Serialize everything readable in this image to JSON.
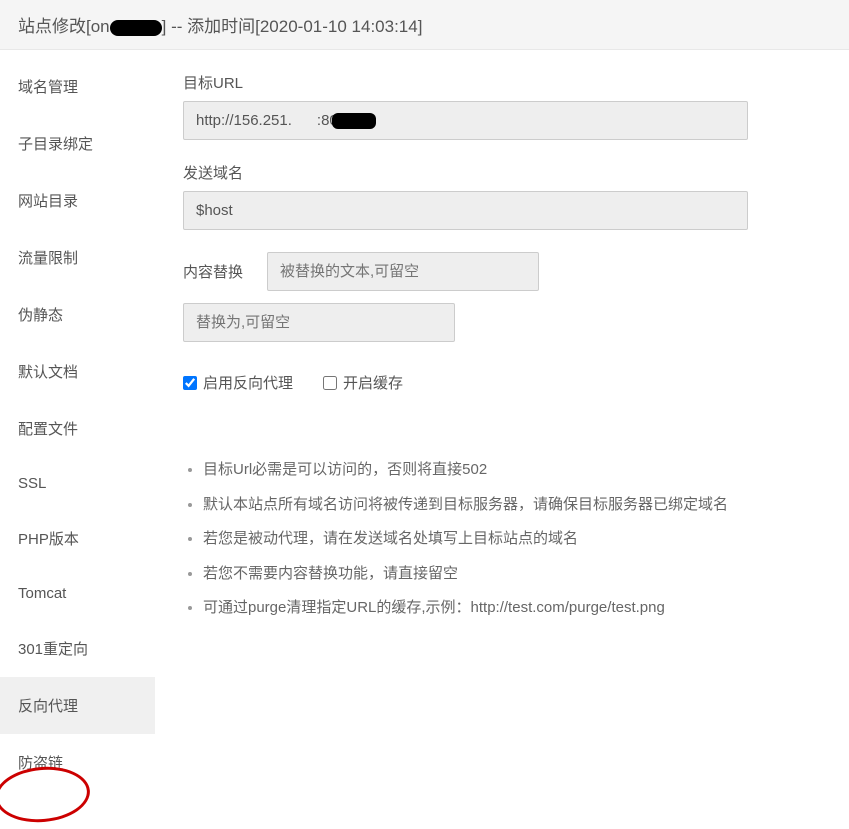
{
  "header": {
    "prefix": "站点修改[on",
    "suffix": "] -- 添加时间[2020-01-10 14:03:14]"
  },
  "sidebar": {
    "items": [
      {
        "label": "域名管理"
      },
      {
        "label": "子目录绑定"
      },
      {
        "label": "网站目录"
      },
      {
        "label": "流量限制"
      },
      {
        "label": "伪静态"
      },
      {
        "label": "默认文档"
      },
      {
        "label": "配置文件"
      },
      {
        "label": "SSL"
      },
      {
        "label": "PHP版本"
      },
      {
        "label": "Tomcat"
      },
      {
        "label": "301重定向"
      },
      {
        "label": "反向代理"
      },
      {
        "label": "防盗链"
      }
    ]
  },
  "form": {
    "target_url_label": "目标URL",
    "target_url_value_prefix": "http://156.251.",
    "target_url_value_suffix": ":8000",
    "send_domain_label": "发送域名",
    "send_domain_value": "$host",
    "content_replace_label": "内容替换",
    "content_replace_placeholder1": "被替换的文本,可留空",
    "content_replace_placeholder2": "替换为,可留空",
    "enable_proxy_label": "启用反向代理",
    "enable_cache_label": "开启缓存"
  },
  "notes": [
    "目标Url必需是可以访问的，否则将直接502",
    "默认本站点所有域名访问将被传递到目标服务器，请确保目标服务器已绑定域名",
    "若您是被动代理，请在发送域名处填写上目标站点的域名",
    "若您不需要内容替换功能，请直接留空",
    "可通过purge清理指定URL的缓存,示例：http://test.com/purge/test.png"
  ]
}
